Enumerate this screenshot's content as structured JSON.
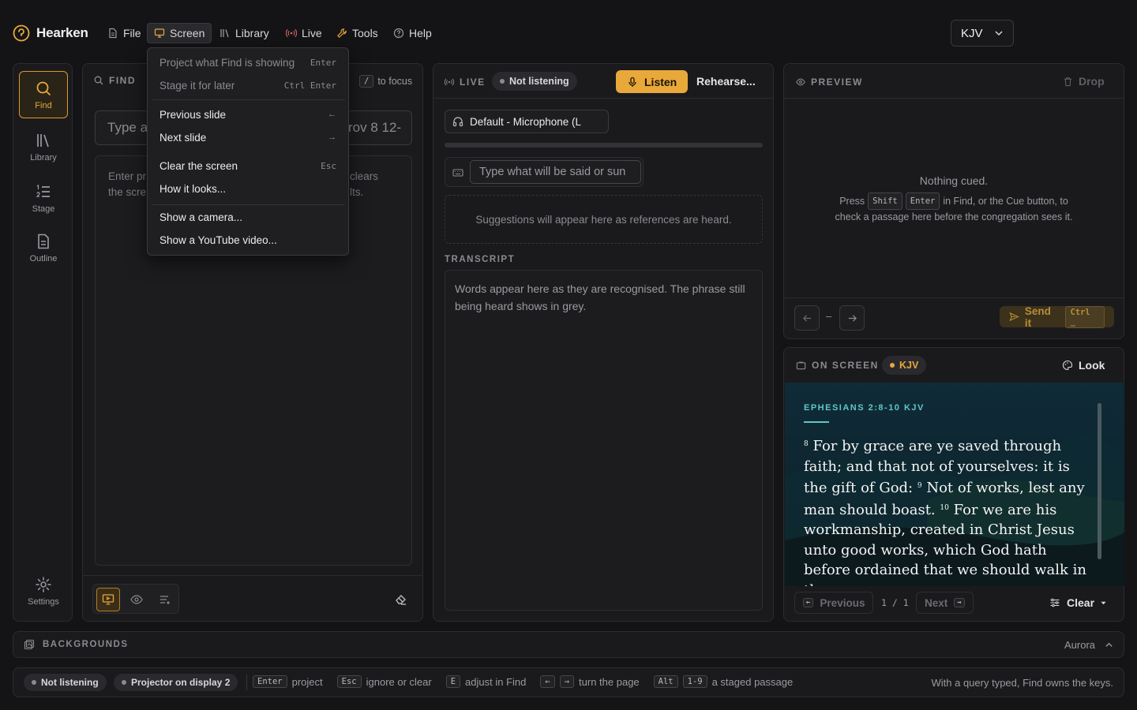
{
  "app": {
    "title": "Hearken"
  },
  "menubar": {
    "items": [
      {
        "label": "File",
        "icon": "file-icon"
      },
      {
        "label": "Screen",
        "icon": "monitor-icon"
      },
      {
        "label": "Library",
        "icon": "library-icon"
      },
      {
        "label": "Live",
        "icon": "broadcast-icon"
      },
      {
        "label": "Tools",
        "icon": "wrench-icon"
      },
      {
        "label": "Help",
        "icon": "help-icon"
      }
    ],
    "version": "KJV"
  },
  "screen_menu": {
    "items": [
      {
        "label": "Project what Find is showing",
        "shortcut": "Enter",
        "disabled": true
      },
      {
        "label": "Stage it for later",
        "shortcut": "Ctrl Enter",
        "disabled": true
      },
      {
        "label": "Previous slide",
        "shortcut": "←"
      },
      {
        "label": "Next slide",
        "shortcut": "→"
      },
      {
        "label": "Clear the screen",
        "shortcut": "Esc"
      },
      {
        "label": "How it looks..."
      },
      {
        "label": "Show a camera..."
      },
      {
        "label": "Show a YouTube video..."
      }
    ]
  },
  "rail": {
    "items": [
      {
        "label": "Find",
        "icon": "search-icon",
        "active": true
      },
      {
        "label": "Library",
        "icon": "library-icon"
      },
      {
        "label": "Stage",
        "icon": "list-ordered-icon"
      },
      {
        "label": "Outline",
        "icon": "document-icon"
      }
    ],
    "settings": "Settings"
  },
  "find": {
    "header": "FIND",
    "focus_key": "/",
    "focus_hint": "to focus",
    "input_placeholder_visible": "Type a",
    "input_placeholder_tail": "rov 8 12-",
    "help_left_1": "Enter pr",
    "help_left_2": "the scre",
    "help_right_1": "clears",
    "help_right_2": "lts."
  },
  "live": {
    "header": "LIVE",
    "status": "Not listening",
    "listen": "Listen",
    "rehearse": "Rehearse...",
    "mic": "Default - Microphone (L",
    "type_placeholder": "Type what will be said or sun",
    "suggestions": "Suggestions will appear here as references are heard.",
    "transcript_label": "TRANSCRIPT",
    "transcript_placeholder": "Words appear here as they are recognised. The phrase still being heard shows in grey."
  },
  "preview": {
    "header": "PREVIEW",
    "drop": "Drop",
    "nothing": "Nothing cued.",
    "press": "Press",
    "key1": "Shift",
    "key2": "Enter",
    "line1_tail": "in Find, or the Cue button, to",
    "line2": "check a passage here before the congregation sees it.",
    "dash": "–",
    "send": "Send it",
    "send_key": "Ctrl _"
  },
  "onscreen": {
    "header": "ON SCREEN",
    "version": "KJV",
    "look": "Look",
    "reference": "EPHESIANS 2:8-10 KJV",
    "verses": [
      {
        "num": "8",
        "text": "For by grace are ye saved through faith; and that not of yourselves: it is the gift of God:"
      },
      {
        "num": "9",
        "text": "Not of works, lest any man should boast."
      },
      {
        "num": "10",
        "text": "For we are his workmanship, created in Christ Jesus unto good works, which God hath before ordained that we should walk in them."
      }
    ],
    "previous": "Previous",
    "page": "1 / 1",
    "next": "Next",
    "clear": "Clear"
  },
  "backgrounds": {
    "label": "BACKGROUNDS",
    "current": "Aurora"
  },
  "statusbar": {
    "listening": "Not listening",
    "projector": "Projector on display 2",
    "hints": [
      {
        "keys": [
          "Enter"
        ],
        "text": "project"
      },
      {
        "keys": [
          "Esc"
        ],
        "text": "ignore or clear"
      },
      {
        "keys": [
          "E"
        ],
        "text": "adjust in Find"
      },
      {
        "keys": [
          "←",
          "→"
        ],
        "text": "turn the page"
      },
      {
        "keys": [
          "Alt",
          "1-9"
        ],
        "text": "a staged passage"
      }
    ],
    "right": "With a query typed, Find owns the keys."
  },
  "colors": {
    "accent": "#e8a83a",
    "background": "#141416",
    "panel": "#1a1a1d"
  }
}
